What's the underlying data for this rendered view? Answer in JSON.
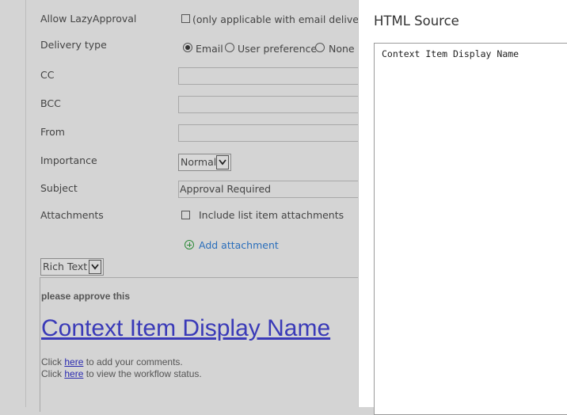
{
  "form": {
    "lazy_approval": {
      "label": "Allow LazyApproval",
      "checkbox_text": "(only applicable with email delivery)"
    },
    "delivery_type": {
      "label": "Delivery type",
      "options": [
        "Email",
        "User preference",
        "None"
      ],
      "selected": "Email"
    },
    "cc": {
      "label": "CC",
      "value": ""
    },
    "bcc": {
      "label": "BCC",
      "value": ""
    },
    "from": {
      "label": "From",
      "value": ""
    },
    "importance": {
      "label": "Importance",
      "value": "Normal"
    },
    "subject": {
      "label": "Subject",
      "value": "Approval Required"
    },
    "attachments": {
      "label": "Attachments",
      "checkbox_text": "Include list item attachments",
      "add_link": "Add attachment"
    },
    "format": {
      "value": "Rich Text"
    }
  },
  "editor": {
    "intro": "please approve this",
    "link_title": "Context Item Display Name",
    "line1": {
      "prefix": "Click ",
      "link": "here",
      "suffix": " to add your comments."
    },
    "line2": {
      "prefix": "Click ",
      "link": "here",
      "suffix": " to view the workflow status."
    }
  },
  "panel": {
    "title": "HTML Source",
    "source": "Context Item Display Name"
  }
}
